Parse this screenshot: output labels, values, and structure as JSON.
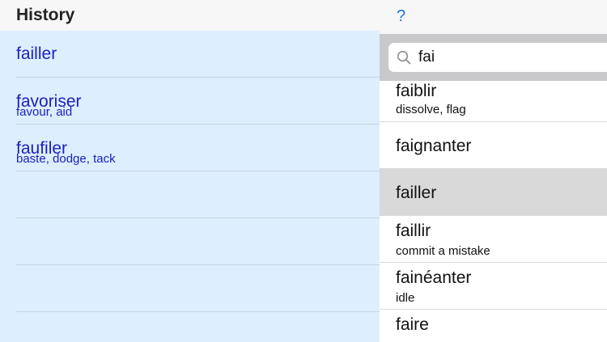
{
  "history": {
    "title": "History",
    "items": [
      {
        "word": "failler",
        "sub": ""
      },
      {
        "word": "favoriser",
        "sub": "favour, aid"
      },
      {
        "word": "faufiler",
        "sub": "baste, dodge, tack"
      },
      {
        "word": "",
        "sub": ""
      },
      {
        "word": "",
        "sub": ""
      },
      {
        "word": "",
        "sub": ""
      }
    ]
  },
  "header": {
    "help_label": "?"
  },
  "search": {
    "value": "fai",
    "icon": "search-icon"
  },
  "results": [
    {
      "word": "faiblir",
      "sub": "dissolve, flag"
    },
    {
      "word": "faignanter",
      "sub": ""
    },
    {
      "word": "failler",
      "sub": "",
      "selected": true
    },
    {
      "word": "faillir",
      "sub": "commit a mistake"
    },
    {
      "word": "fainéanter",
      "sub": "idle"
    },
    {
      "word": "faire",
      "sub": ""
    }
  ],
  "colors": {
    "accent": "#1a1fc0",
    "help": "#1a73e8",
    "history_bg": "#ddeeff",
    "selected_bg": "#d9d9d9"
  }
}
